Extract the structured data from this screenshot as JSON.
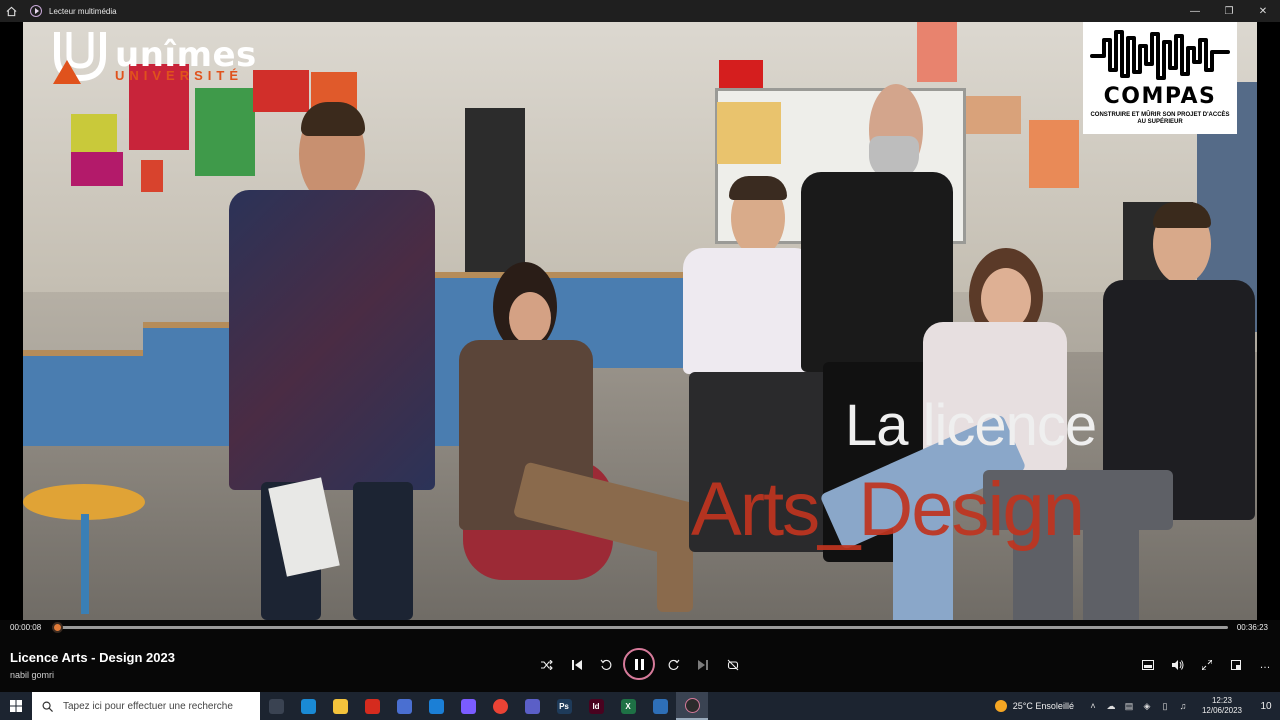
{
  "window": {
    "title": "Lecteur multimédia"
  },
  "video": {
    "logo_left": {
      "name": "unîmes",
      "subtitle": "UNIVERSITÉ"
    },
    "logo_right": {
      "name": "COMPAS",
      "tagline": "CONSTRUIRE ET MÛRIR SON PROJET D'ACCÈS AU SUPÉRIEUR"
    },
    "overlay_line1": "La licence",
    "overlay_line2": "Arts_Design"
  },
  "player": {
    "elapsed": "00:00:08",
    "total": "00:36:23",
    "progress_fraction": 0.004,
    "title": "Licence Arts - Design 2023",
    "artist": "nabil gomri",
    "colors": {
      "accent": "#e07b39",
      "play_ring": "#d67a9a"
    }
  },
  "taskbar": {
    "search_placeholder": "Tapez ici pour effectuer une recherche",
    "apps": [
      {
        "name": "task-view",
        "label": "",
        "color": "#3a4352"
      },
      {
        "name": "edge",
        "label": "",
        "color": "#1a8ad4"
      },
      {
        "name": "file-explorer",
        "label": "",
        "color": "#f3c33c"
      },
      {
        "name": "acrobat",
        "label": "",
        "color": "#d52b1e"
      },
      {
        "name": "store",
        "label": "",
        "color": "#4a6fd1"
      },
      {
        "name": "mail",
        "label": "",
        "color": "#1b7fd6"
      },
      {
        "name": "copilot",
        "label": "",
        "color": "#7a5cff"
      },
      {
        "name": "chrome",
        "label": "",
        "color": "#ea4335"
      },
      {
        "name": "teams",
        "label": "",
        "color": "#5b5fc7"
      },
      {
        "name": "photoshop",
        "label": "Ps",
        "color": "#1e3b5a"
      },
      {
        "name": "indesign",
        "label": "Id",
        "color": "#49021f"
      },
      {
        "name": "excel",
        "label": "X",
        "color": "#1e7145"
      },
      {
        "name": "photos",
        "label": "",
        "color": "#2e6fb7"
      },
      {
        "name": "media-player",
        "label": "",
        "color": "#2b2b2b"
      }
    ],
    "weather": {
      "temp": "25°C",
      "condition": "Ensoleillé"
    },
    "clock": {
      "time": "12:23",
      "date": "12/06/2023"
    },
    "notifications": "10"
  }
}
